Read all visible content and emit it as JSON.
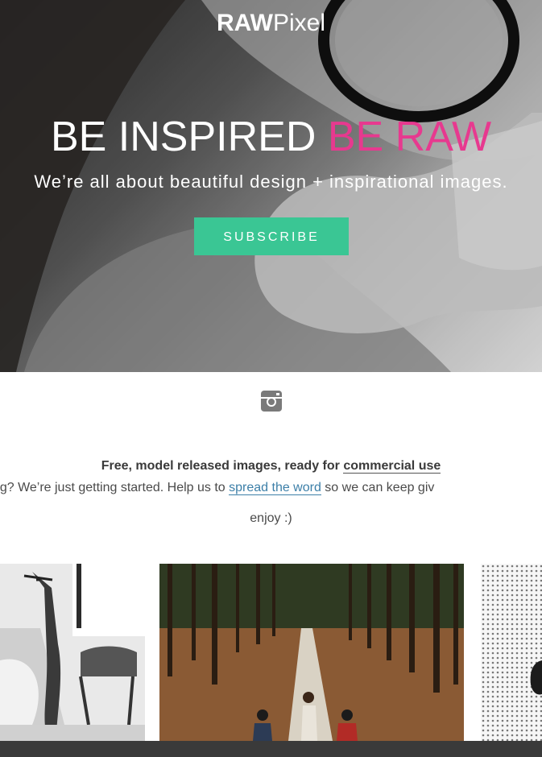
{
  "hero": {
    "logo_bold": "RAW",
    "logo_light": "Pixel",
    "headline_white": "BE INSPIRED ",
    "headline_pink": "BE RAW",
    "tagline": "We’re all about beautiful design + inspirational images.",
    "subscribe_label": "SUBSCRIBE"
  },
  "social": {
    "icon": "instagram-icon"
  },
  "info": {
    "line1_text": "Free, model released images, ready for ",
    "line1_link": "commercial use",
    "line2_prefix": "t we’re doing? We’re just getting started. Help us to ",
    "line2_link": "spread the word",
    "line2_suffix": " so we can keep giv",
    "line3": "enjoy :)"
  },
  "gallery": {
    "images": [
      "saxophone-photo",
      "forest-path-photo",
      "halftone-photo"
    ]
  },
  "colors": {
    "accent_pink": "#e7398f",
    "subscribe_green": "#3ac694",
    "link_blue": "#3c7fa8",
    "footer_dark": "#3a3a3a"
  }
}
